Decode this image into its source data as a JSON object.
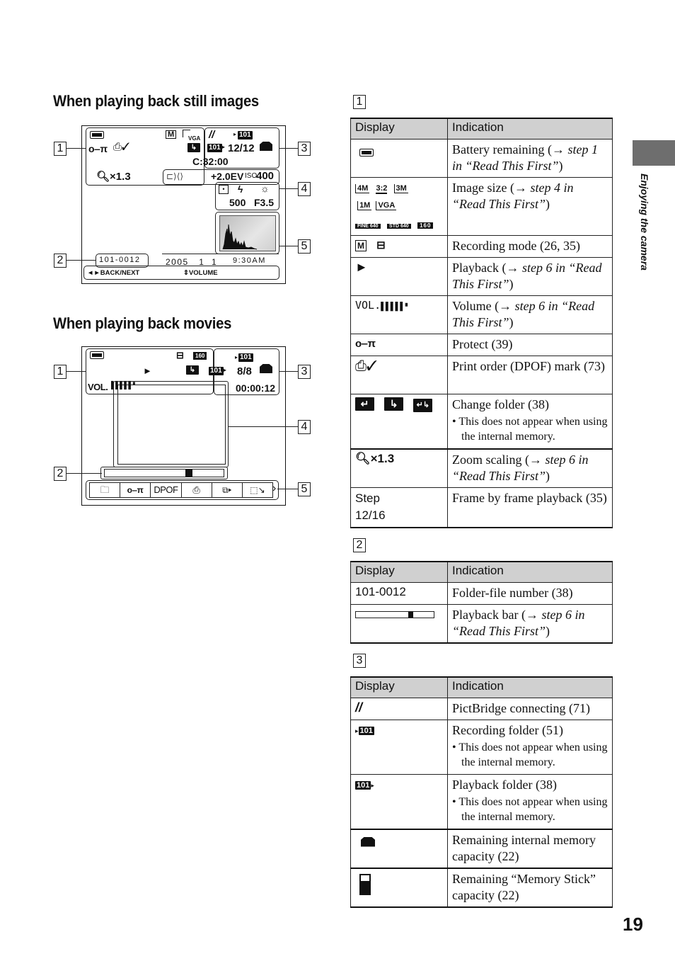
{
  "headings": {
    "still": "When playing back still images",
    "movies": "When playing back movies"
  },
  "callouts": [
    "1",
    "2",
    "3",
    "4",
    "5"
  ],
  "still_screen": {
    "icons": [
      "battery-icon",
      "recording-mode-multi-icon",
      "image-size-vga-icon",
      "protect-key-icon",
      "print-order-icon",
      "change-folder-icon",
      "pictbridge-icon",
      "recording-folder-icon",
      "playback-folder-icon",
      "internal-memory-icon",
      "hand-shake-icon",
      "metering-spot-icon",
      "flash-icon",
      "white-balance-icon"
    ],
    "vga_label": "VGA",
    "zoom_scaling": "×1.3",
    "recording_folder": "101",
    "playback_folder": "101",
    "image_count": "12/12",
    "counter": "C:32:00",
    "exposure": "+2.0EV",
    "iso_prefix": "ISO",
    "iso_value": "400",
    "shutter": "500",
    "aperture": "F3.5",
    "file_number": "101-0012",
    "date": "2005   1  1",
    "time": "9:30AM",
    "nav_back_next": "◄►BACK/NEXT",
    "nav_volume": "⇕VOLUME"
  },
  "movie_screen": {
    "image_quality": "160",
    "recording_folder": "101",
    "playback_folder": "101",
    "image_count": "8/8",
    "vol_label": "VOL.",
    "time_counter": "00:00:12",
    "playback_position": 0.72,
    "toolbar_items": [
      "folder-icon",
      "protect-key-icon",
      "DPOF",
      "print-icon",
      "slideshow-icon",
      "resize-icon"
    ],
    "toolbar_dpof": "DPOF",
    "toolbar_more": "›"
  },
  "table1": {
    "number": "1",
    "header": {
      "display": "Display",
      "indication": "Indication"
    },
    "rows": [
      {
        "display_icon": "battery-icon",
        "indication": "Battery remaining (→ ",
        "italic": "step 1 in “Read This First”",
        "tail": ")"
      },
      {
        "display_icon": "image-size-icons",
        "icons": [
          "4M",
          "3:2",
          "3M",
          "1M",
          "VGA",
          "FINE 640",
          "STD 640",
          "160"
        ],
        "indication": "Image size (→ ",
        "italic": "step 4 in “Read This First”",
        "tail": ")"
      },
      {
        "display_icon": "recording-mode-icons",
        "indication": "Recording mode (26, 35)"
      },
      {
        "display_icon": "play-icon",
        "indication": "Playback (→ ",
        "italic": "step 6 in “Read This First”",
        "tail": ")"
      },
      {
        "display_text": "VOL.",
        "display_icon": "volume-bars-icon",
        "indication": "Volume (→ ",
        "italic": "step 6 in “Read This First”",
        "tail": ")"
      },
      {
        "display_icon": "protect-key-icon",
        "indication": "Protect (39)"
      },
      {
        "display_icon": "print-order-icon",
        "indication": "Print order (DPOF) mark (73)"
      },
      {
        "display_icon": "change-folder-icons",
        "indication": "Change folder (38)",
        "note": "• This does not appear when using the internal memory."
      },
      {
        "display_text": "×1.3",
        "display_icon": "zoom-icon",
        "indication": "Zoom scaling (→ ",
        "italic": "step 6 in “Read This First”",
        "tail": ")"
      },
      {
        "display_text": "Step 12/16",
        "indication": "Frame by frame playback (35)"
      }
    ]
  },
  "table2": {
    "number": "2",
    "header": {
      "display": "Display",
      "indication": "Indication"
    },
    "rows": [
      {
        "display_text": "101-0012",
        "indication": "Folder-file number (38)"
      },
      {
        "display_icon": "playback-bar-icon",
        "playback_position": 0.72,
        "indication": "Playback bar (→ ",
        "italic": "step 6 in “Read This First”",
        "tail": ")"
      }
    ]
  },
  "table3": {
    "number": "3",
    "header": {
      "display": "Display",
      "indication": "Indication"
    },
    "rows": [
      {
        "display_icon": "pictbridge-icon",
        "indication": "PictBridge connecting (71)"
      },
      {
        "display_icon": "recording-folder-icon",
        "display_text": "101",
        "indication": "Recording folder (51)",
        "note": "• This does not appear when using the internal memory."
      },
      {
        "display_icon": "playback-folder-icon",
        "display_text": "101",
        "indication": "Playback folder (38)",
        "note": "• This does not appear when using the internal memory."
      },
      {
        "display_icon": "internal-memory-icon",
        "indication": "Remaining internal memory capacity (22)"
      },
      {
        "display_icon": "memory-stick-icon",
        "indication": "Remaining “Memory Stick” capacity (22)"
      }
    ]
  },
  "side_tab": {
    "label": "Enjoying the camera",
    "color": "#6e6e6e"
  },
  "page_number": "19"
}
